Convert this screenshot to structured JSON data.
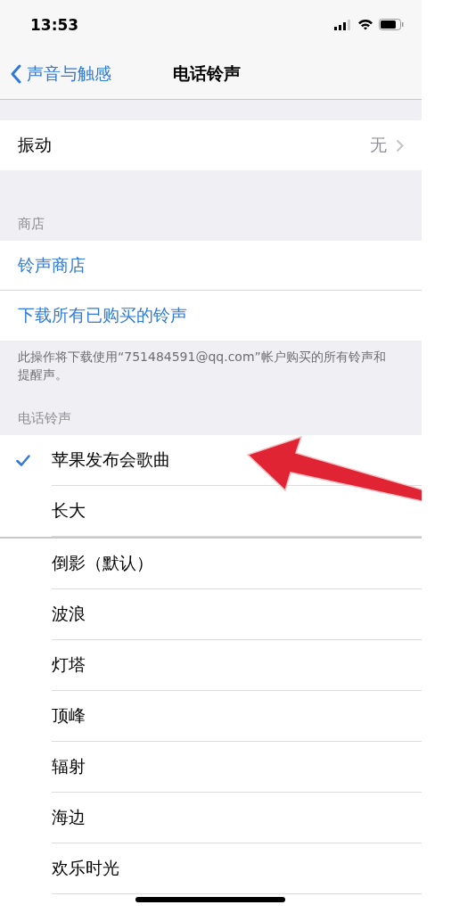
{
  "status_bar": {
    "time": "13:53"
  },
  "nav": {
    "back": "声音与触感",
    "title": "电话铃声"
  },
  "vibration": {
    "label": "振动",
    "value": "无"
  },
  "store": {
    "header": "商店",
    "links": [
      "铃声商店",
      "下载所有已购买的铃声"
    ],
    "footer": "此操作将下载使用“751484591@qq.com”帐户购买的所有铃声和提醒声。"
  },
  "ringtones": {
    "header": "电话铃声",
    "groups": [
      {
        "items": [
          {
            "label": "苹果发布会歌曲",
            "selected": true
          },
          {
            "label": "长大",
            "selected": false
          }
        ]
      },
      {
        "items": [
          {
            "label": "倒影（默认）",
            "selected": false
          },
          {
            "label": "波浪",
            "selected": false
          },
          {
            "label": "灯塔",
            "selected": false
          },
          {
            "label": "顶峰",
            "selected": false
          },
          {
            "label": "辐射",
            "selected": false
          },
          {
            "label": "海边",
            "selected": false
          },
          {
            "label": "欢乐时光",
            "selected": false
          }
        ]
      }
    ]
  }
}
